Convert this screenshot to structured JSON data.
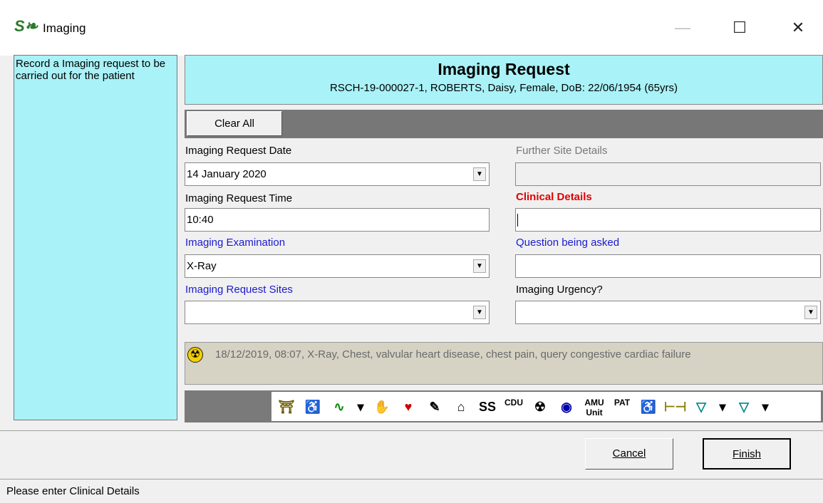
{
  "window": {
    "title": "Imaging",
    "minimize": "—",
    "maximize": "☐",
    "close": "✕"
  },
  "help_text": "Record a Imaging request to be carried out for the patient",
  "header": {
    "title": "Imaging Request",
    "patient": "RSCH-19-000027-1, ROBERTS, Daisy, Female, DoB: 22/06/1954 (65yrs)"
  },
  "clear_button": "Clear All",
  "fields": {
    "request_date": {
      "label": "Imaging Request Date",
      "value": "14  January   2020"
    },
    "request_time": {
      "label": "Imaging Request Time",
      "value": "10:40"
    },
    "examination": {
      "label": "Imaging Examination",
      "value": "X-Ray"
    },
    "request_sites": {
      "label": "Imaging Request Sites",
      "value": ""
    },
    "further_site": {
      "label": "Further Site Details",
      "value": ""
    },
    "clinical_details": {
      "label": "Clinical Details",
      "value": ""
    },
    "question": {
      "label": "Question being asked",
      "value": ""
    },
    "urgency": {
      "label": "Imaging Urgency?",
      "value": ""
    }
  },
  "history": "18/12/2019, 08:07, X-Ray, Chest, valvular heart disease, chest pain, query congestive cardiac failure",
  "toolbar": [
    {
      "icon": "ladder-icon",
      "glyph": "⛩"
    },
    {
      "icon": "wheelchair-icon",
      "glyph": "♿"
    },
    {
      "icon": "ecg-icon",
      "glyph": "∿"
    },
    {
      "icon": "dropdown-arrow-icon",
      "glyph": "▾"
    },
    {
      "icon": "hand-icon",
      "glyph": "✋"
    },
    {
      "icon": "person-red-icon",
      "glyph": "♥"
    },
    {
      "icon": "pencil-icon",
      "glyph": "✎"
    },
    {
      "icon": "home-icon",
      "glyph": "⌂"
    },
    {
      "icon": "ss-icon",
      "glyph": "SS"
    },
    {
      "icon": "cdu-icon",
      "glyph": "CDU"
    },
    {
      "icon": "radiation-icon",
      "glyph": "☢"
    },
    {
      "icon": "disc-icon",
      "glyph": "◉"
    },
    {
      "icon": "amu-unit-icon",
      "glyph": "AMU Unit"
    },
    {
      "icon": "pat-icon",
      "glyph": "PAT"
    },
    {
      "icon": "chair-icon",
      "glyph": "♿"
    },
    {
      "icon": "bed-icon",
      "glyph": "⊢⊣"
    },
    {
      "icon": "bandage-icon",
      "glyph": "▽"
    },
    {
      "icon": "dropdown-arrow-icon",
      "glyph": "▾"
    },
    {
      "icon": "bandage2-icon",
      "glyph": "▽"
    },
    {
      "icon": "dropdown-arrow-icon",
      "glyph": "▾"
    }
  ],
  "buttons": {
    "cancel": "Cancel",
    "finish": "Finish"
  },
  "status": "Please enter Clinical Details"
}
